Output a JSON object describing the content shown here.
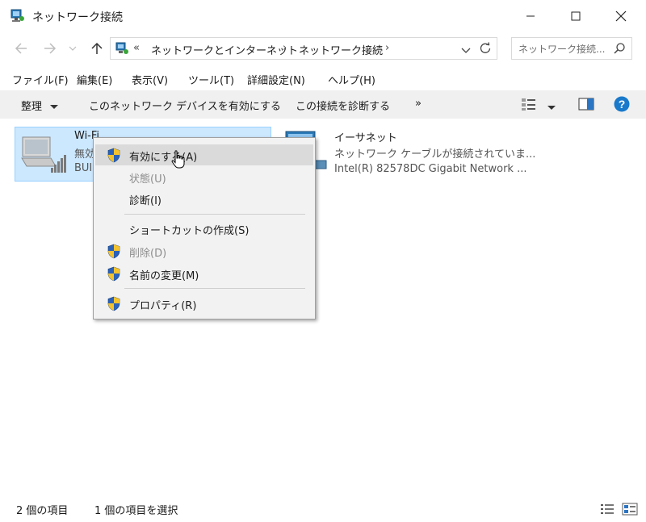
{
  "window": {
    "title": "ネットワーク接続"
  },
  "address": {
    "overflow": "«",
    "crumbs": [
      "ネットワークとインターネット",
      "ネットワーク接続"
    ],
    "separator": "›",
    "search_placeholder": "ネットワーク接続..."
  },
  "menubar": {
    "items": [
      "ファイル(F)",
      "編集(E)",
      "表示(V)",
      "ツール(T)",
      "詳細設定(N)",
      "ヘルプ(H)"
    ]
  },
  "commandbar": {
    "organize": "整理",
    "enable_device": "このネットワーク デバイスを有効にする",
    "diagnose": "この接続を診断する",
    "more": "»"
  },
  "items": {
    "wifi": {
      "name": "Wi-Fi",
      "status": "無効",
      "device": "BUI"
    },
    "ethernet": {
      "name": "イーサネット",
      "status": "ネットワーク ケーブルが接続されていま...",
      "device": "Intel(R) 82578DC Gigabit Network ..."
    }
  },
  "context_menu": {
    "enable": "有効にする(A)",
    "status": "状態(U)",
    "diagnose": "診断(I)",
    "create_shortcut": "ショートカットの作成(S)",
    "delete": "削除(D)",
    "rename": "名前の変更(M)",
    "properties": "プロパティ(R)"
  },
  "statusbar": {
    "item_count": "2 個の項目",
    "selected": "1 個の項目を選択"
  },
  "colors": {
    "selection": "#cce8ff",
    "help_blue": "#1979ca"
  }
}
